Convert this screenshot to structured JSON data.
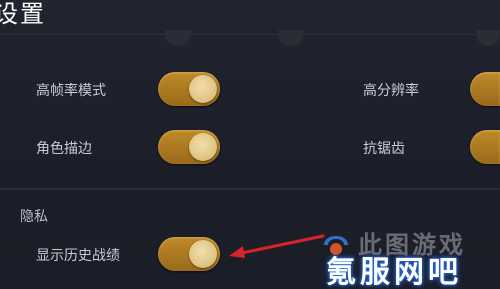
{
  "header": {
    "title": "设置"
  },
  "graphics": {
    "rows": [
      {
        "left_label": "高帧率模式",
        "left_on": true,
        "right_label": "高分辨率",
        "right_on": true
      },
      {
        "left_label": "角色描边",
        "left_on": true,
        "right_label": "抗锯齿",
        "right_on": true
      }
    ]
  },
  "privacy": {
    "section_title": "隐私",
    "show_history_label": "显示历史战绩",
    "show_history_on": true
  },
  "overlay": {
    "watermark_top": "此图游戏",
    "watermark_main": "氪服网吧",
    "arrow_color": "#d8232a"
  },
  "colors": {
    "toggle_track": "#b07c24",
    "toggle_thumb": "#e8cf94",
    "background": "#1c1e2b"
  }
}
